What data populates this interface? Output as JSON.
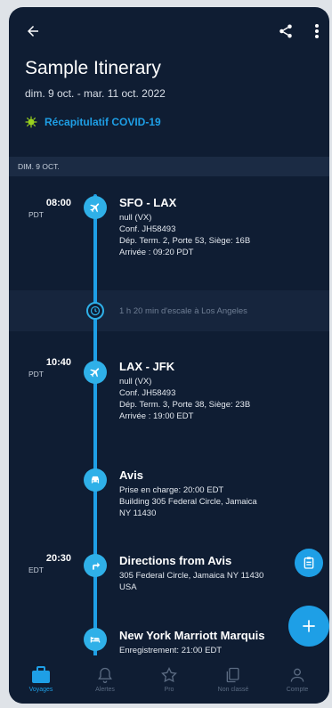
{
  "header": {
    "back_icon": "arrow-left-icon",
    "share_icon": "share-icon",
    "more_icon": "more-vertical-icon"
  },
  "trip": {
    "title": "Sample Itinerary",
    "dates": "dim. 9 oct. - mar. 11 oct. 2022"
  },
  "covid": {
    "label": "Récapitulatif COVID-19",
    "icon": "virus-icon"
  },
  "section": {
    "label": "DIM. 9 OCT."
  },
  "timeline": {
    "flight1": {
      "time": "08:00",
      "tz": "PDT",
      "title": "SFO - LAX",
      "lines": [
        "null (VX)",
        "Conf. JH58493",
        "Dép. Term. 2, Porte 53, Siège: 16B",
        "Arrivée : 09:20 PDT"
      ]
    },
    "layover": {
      "text": "1 h 20 min d'escale à Los Angeles"
    },
    "flight2": {
      "time": "10:40",
      "tz": "PDT",
      "title": "LAX - JFK",
      "lines": [
        "null (VX)",
        "Conf. JH58493",
        "Dép. Term. 3, Porte 38, Siège: 23B",
        "Arrivée : 19:00 EDT"
      ]
    },
    "car": {
      "title": "Avis",
      "lines": [
        "Prise en charge: 20:00 EDT",
        "Building 305 Federal Circle, Jamaica",
        "NY 11430"
      ]
    },
    "directions": {
      "time": "20:30",
      "tz": "EDT",
      "title": "Directions from Avis",
      "lines": [
        "305 Federal Circle, Jamaica NY 11430",
        "USA"
      ]
    },
    "hotel": {
      "title": "New York Marriott Marquis",
      "lines": [
        "Enregistrement: 21:00 EDT"
      ]
    }
  },
  "nav": [
    {
      "label": "Voyages",
      "icon": "suitcase-icon",
      "active": true
    },
    {
      "label": "Alertes",
      "icon": "bell-icon"
    },
    {
      "label": "Pro",
      "icon": "star-icon"
    },
    {
      "label": "Non classé",
      "icon": "documents-icon"
    },
    {
      "label": "Compte",
      "icon": "person-icon"
    }
  ],
  "colors": {
    "background": "#0f1d33",
    "accent": "#1e9fe6",
    "section": "#1b2b44"
  }
}
